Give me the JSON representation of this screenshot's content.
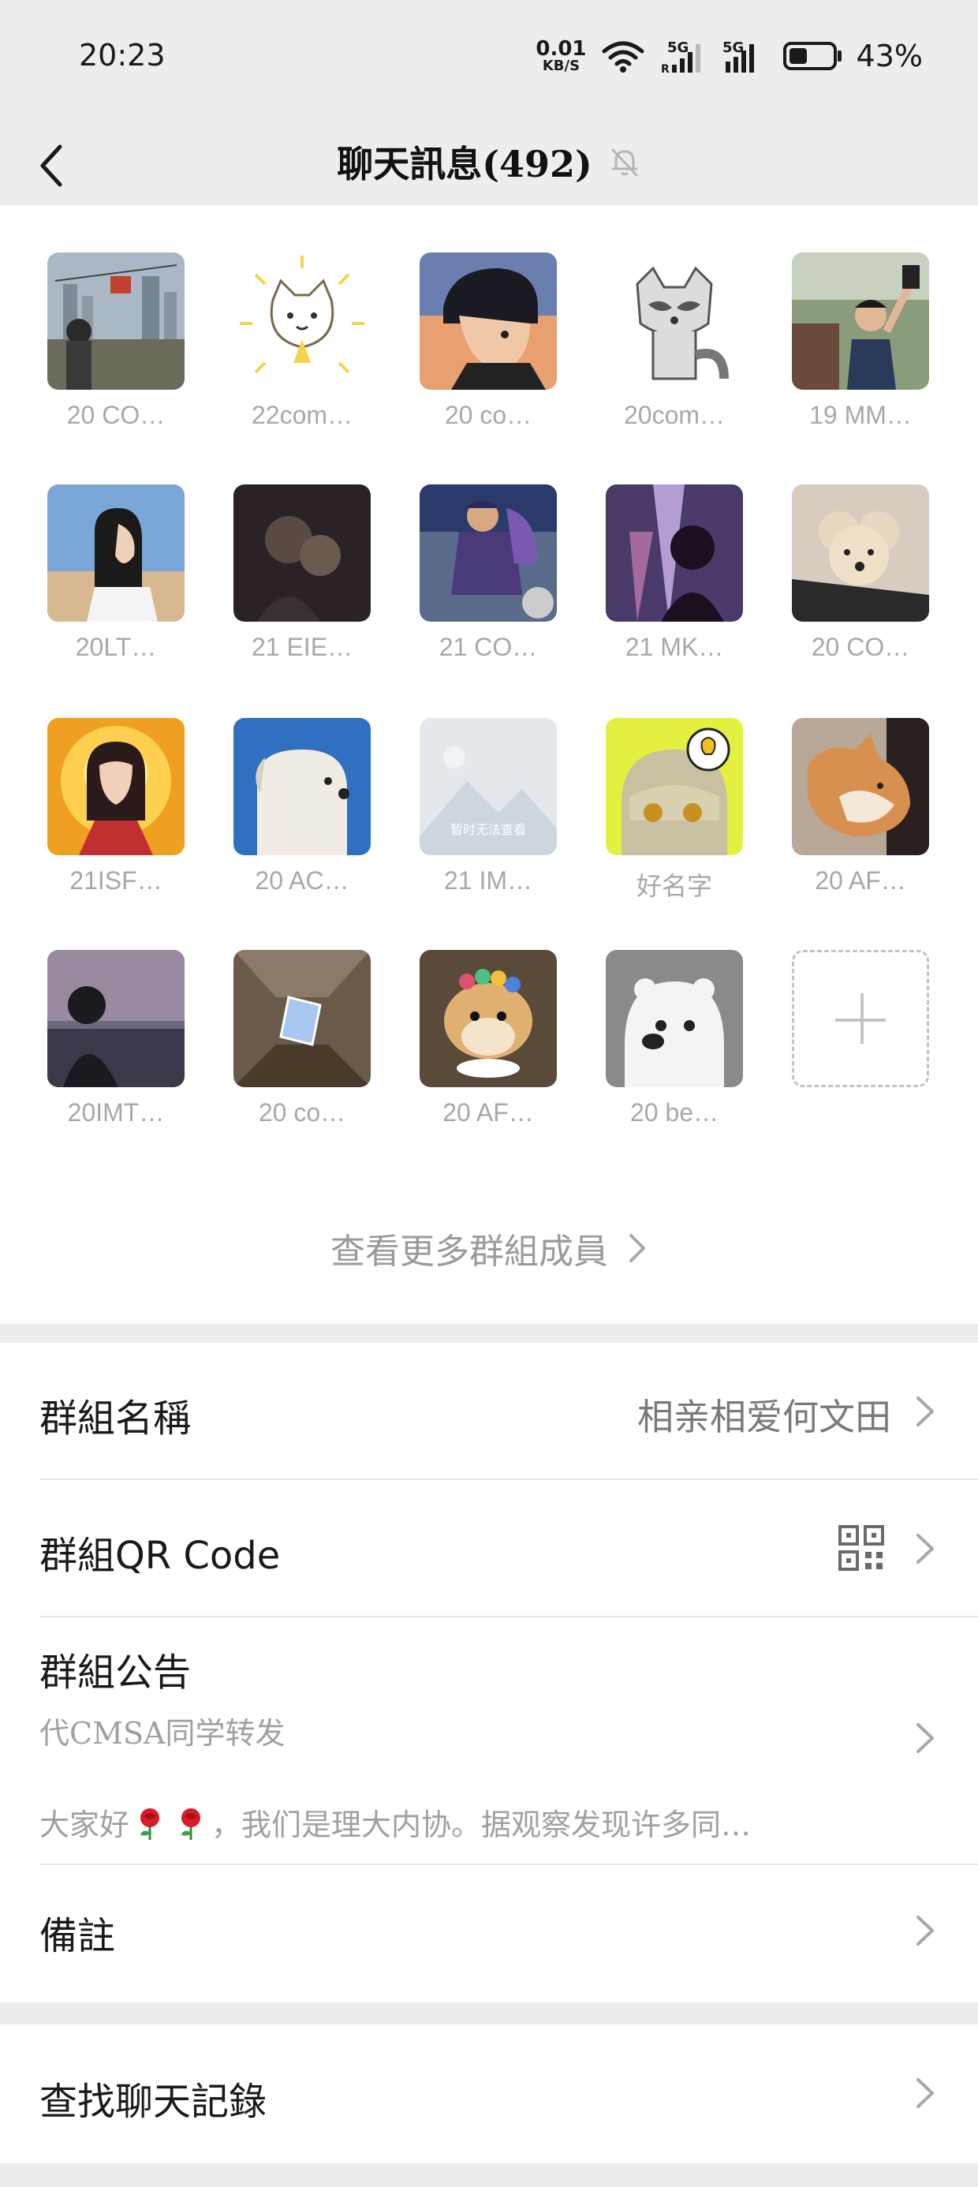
{
  "status_bar": {
    "time": "20:23",
    "net_speed_value": "0.01",
    "net_speed_unit": "KB/S",
    "signal_1_label": "5G",
    "signal_2_label": "5G",
    "battery_percent": 43,
    "battery_text": "43%"
  },
  "nav": {
    "title": "聊天訊息(492)"
  },
  "members": [
    {
      "name": "20 CO…",
      "art": "city"
    },
    {
      "name": "22com…",
      "art": "cat-sticker"
    },
    {
      "name": "20 co…",
      "art": "anime-boy"
    },
    {
      "name": "20com…",
      "art": "raccoon"
    },
    {
      "name": "19 MM…",
      "art": "selfie"
    },
    {
      "name": "20LT…",
      "art": "girl-sky"
    },
    {
      "name": "21 EIE…",
      "art": "dark-couple"
    },
    {
      "name": "21 CO…",
      "art": "backpack"
    },
    {
      "name": "21 MK…",
      "art": "silhouette-light"
    },
    {
      "name": "20 CO…",
      "art": "poodle"
    },
    {
      "name": "21ISF…",
      "art": "golden-girl"
    },
    {
      "name": "20 AC…",
      "art": "white-dog"
    },
    {
      "name": "21 IM…",
      "art": "placeholder",
      "placeholder_text": "暂时无法查看"
    },
    {
      "name": "好名字",
      "art": "lightbulb-cartoon"
    },
    {
      "name": "20 AF…",
      "art": "shiba"
    },
    {
      "name": "20IMT…",
      "art": "sunset"
    },
    {
      "name": "20 co…",
      "art": "skylight"
    },
    {
      "name": "20 AF…",
      "art": "hamster"
    },
    {
      "name": "20 be…",
      "art": "polar-bear"
    }
  ],
  "more_members_label": "查看更多群組成員",
  "settings": {
    "group_name_label": "群組名稱",
    "group_name_value": "相亲相爱何文田",
    "qr_label": "群組QR Code",
    "announcement_label": "群組公告",
    "announcement_author": "代CMSA同学转发",
    "announcement_preview_start": "大家好",
    "announcement_preview_rest": "，我们是理大内协。据观察发现许多同…",
    "remark_label": "備註"
  },
  "search_history_label": "查找聊天記錄",
  "colors": {
    "background": "#ededed",
    "card": "#ffffff",
    "muted_text": "#a8a8a8",
    "divider": "#e8e8e8"
  },
  "icons": {
    "back": "chevron-left-icon",
    "mute": "bell-off-icon",
    "chevron": "chevron-right-icon",
    "qr": "qr-code-icon",
    "add": "plus-icon",
    "wifi": "wifi-icon",
    "battery": "battery-icon",
    "rose": "rose-emoji-icon"
  }
}
